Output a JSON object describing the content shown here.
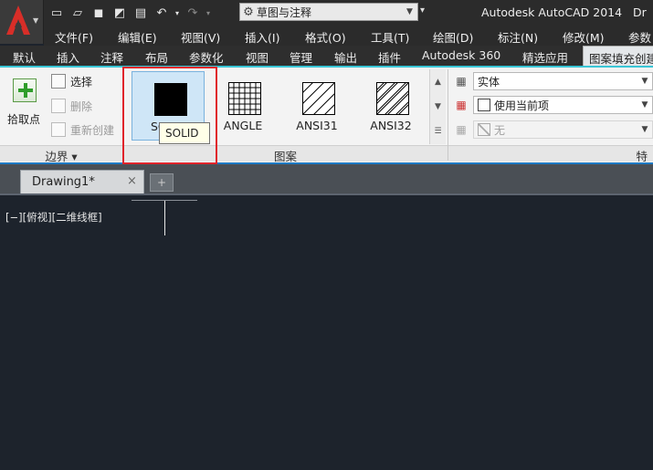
{
  "titlebar": {
    "workspace": "草图与注释",
    "app_title": "Autodesk AutoCAD 2014",
    "app_title_tail": "Dr"
  },
  "menu": [
    "文件(F)",
    "编辑(E)",
    "视图(V)",
    "插入(I)",
    "格式(O)",
    "工具(T)",
    "绘图(D)",
    "标注(N)",
    "修改(M)",
    "参数"
  ],
  "ribbon_tabs": [
    "默认",
    "插入",
    "注释",
    "布局",
    "参数化",
    "视图",
    "管理",
    "输出",
    "插件",
    "Autodesk 360",
    "精选应用",
    "图案填充创建"
  ],
  "boundary": {
    "pick_label": "拾取点",
    "select_label": "选择",
    "remove_label": "删除",
    "recreate_label": "重新创建",
    "panel_title": "边界 ▾"
  },
  "patterns": {
    "items": [
      "SOLID",
      "ANGLE",
      "ANSI31",
      "ANSI32"
    ],
    "selected": "SOLID",
    "panel_title": "图案",
    "tooltip": "SOLID",
    "visible_selected_label": "SO"
  },
  "properties": {
    "type": "实体",
    "color": "使用当前项",
    "background": "无",
    "panel_title": "特"
  },
  "document": {
    "tab": "Drawing1*",
    "viewport_label": "[−][俯视][二维线框]"
  },
  "colors": {
    "highlight": "#e0242b",
    "canvas": "#1d232c",
    "accent": "#1e7ac4"
  }
}
